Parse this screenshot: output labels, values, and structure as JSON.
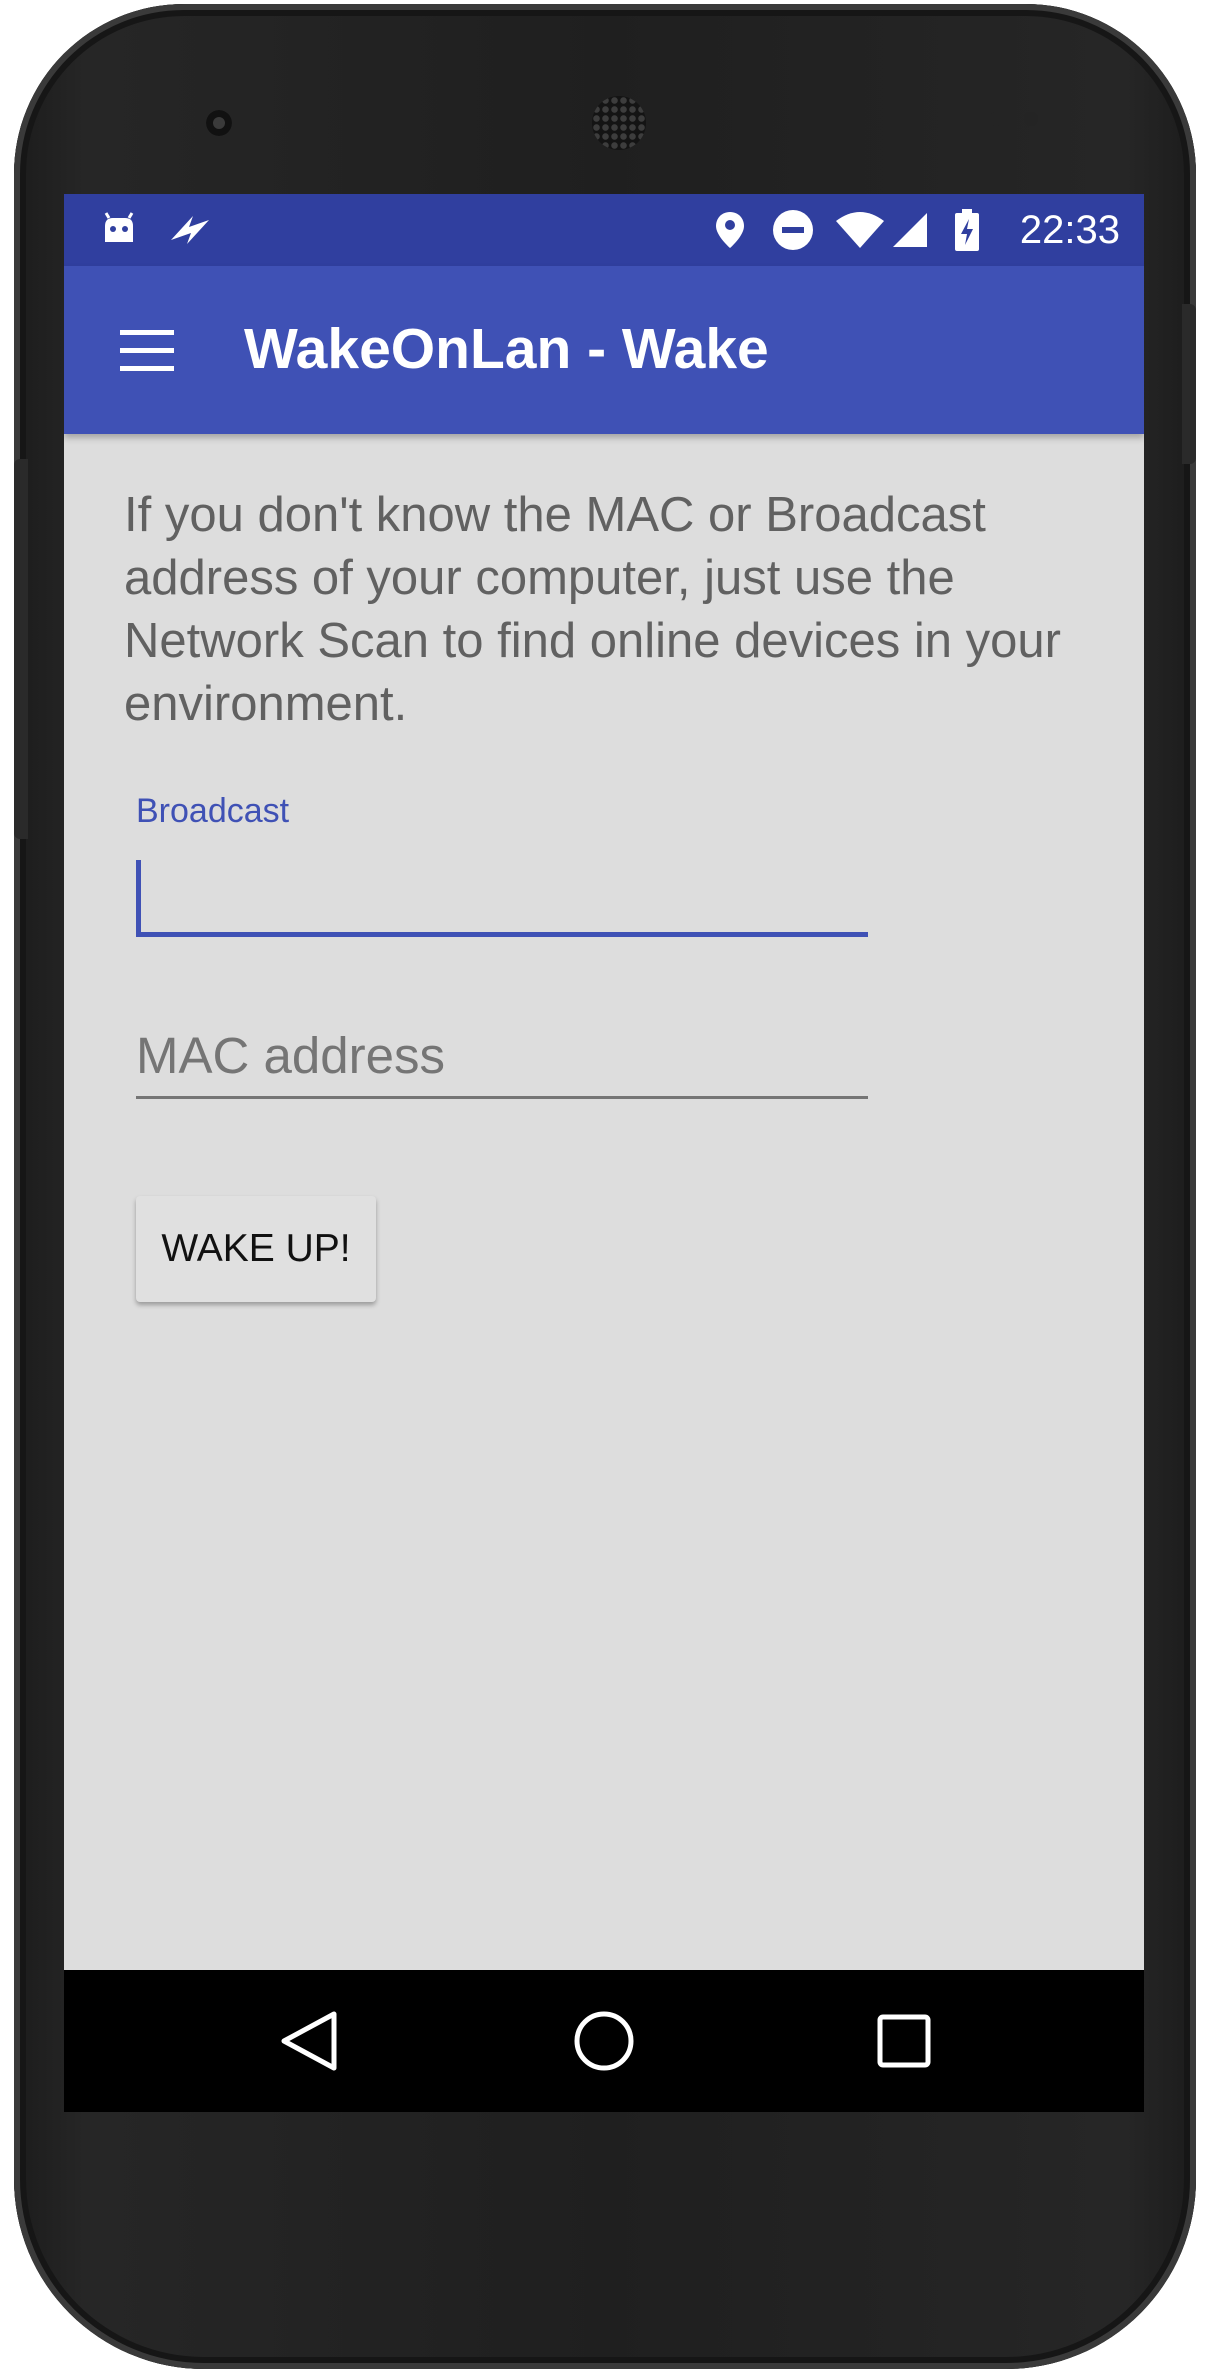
{
  "status_bar": {
    "time": "22:33",
    "icons": [
      "android-debug-icon",
      "flash-icon",
      "location-icon",
      "do-not-disturb-icon",
      "wifi-icon",
      "cell-signal-icon",
      "battery-charging-icon"
    ]
  },
  "app_bar": {
    "title": "WakeOnLan - Wake",
    "menu_icon": "hamburger-menu-icon"
  },
  "content": {
    "info_text": "If you don't know the MAC or Broadcast address of your computer, just use the Network Scan to find online devices in your environment.",
    "broadcast_label": "Broadcast",
    "broadcast_value": "",
    "mac_placeholder": "MAC address",
    "wake_button_label": "WAKE UP!"
  },
  "nav_bar": {
    "buttons": [
      "back-icon",
      "home-icon",
      "recents-icon"
    ]
  },
  "colors": {
    "status_bar": "#303f9f",
    "app_bar": "#3f51b5",
    "accent": "#3f51b5",
    "background": "#dddddd"
  }
}
